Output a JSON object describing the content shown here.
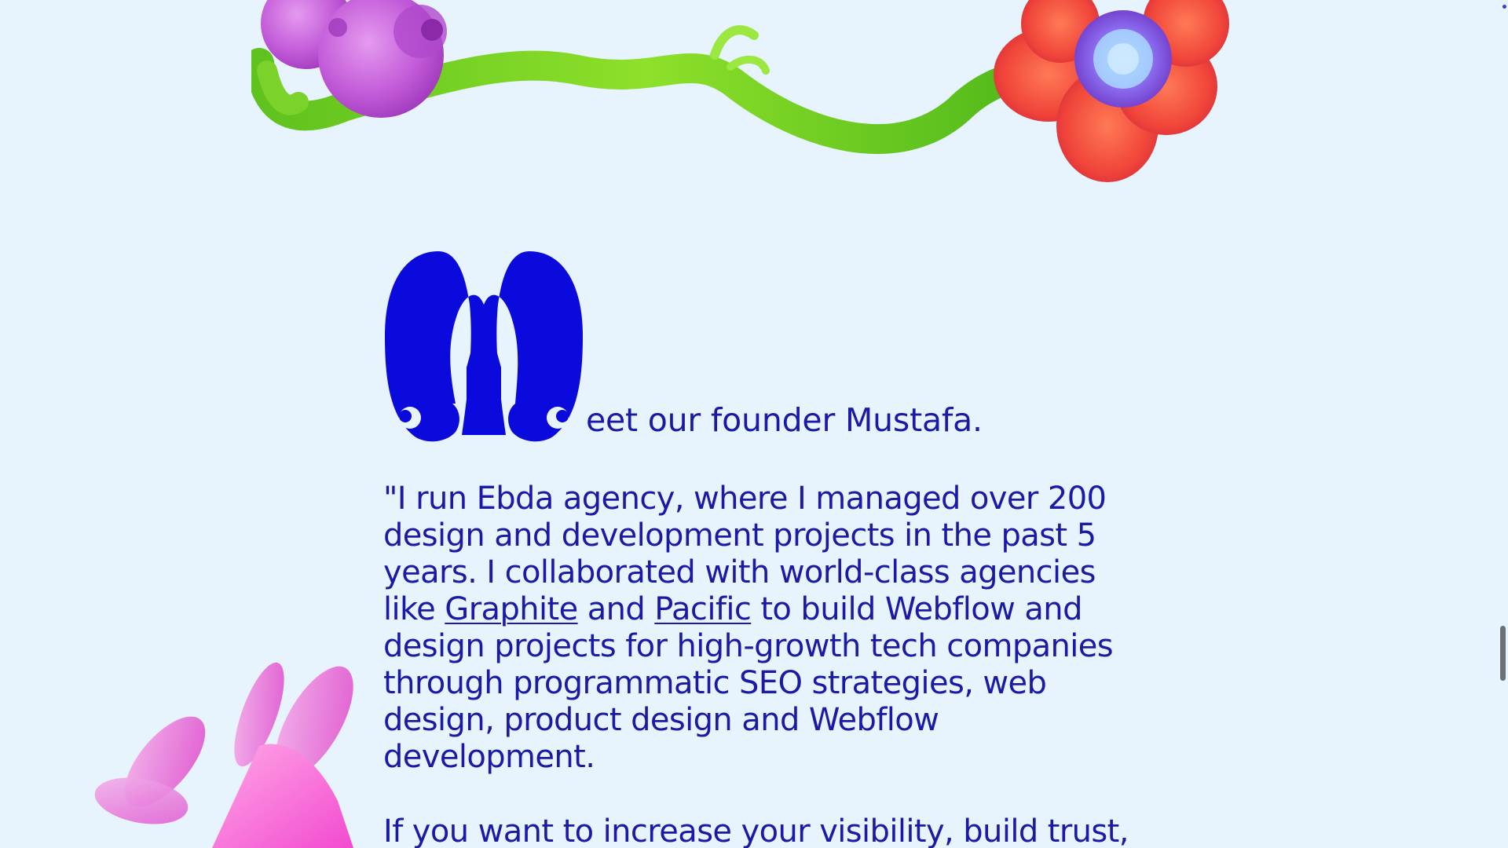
{
  "colors": {
    "background": "#e7f4fd",
    "text": "#1a1aa6",
    "accent": "#0a0adc"
  },
  "decorations": {
    "top": "flower-vine-illustration",
    "bottom": "pink-flower-illustration"
  },
  "heading": {
    "dropcap_letter": "M",
    "rest": "eet our founder Mustafa."
  },
  "quote": {
    "text_before": "\"I run Ebda agency, where I managed over 200 design and development projects in the past 5 years. I collaborated with world-class agencies like ",
    "link_graphite": "Graphite",
    "and_text": " and ",
    "link_pacific": "Pacific",
    "text_after": " to build Webflow and design projects for high-growth tech companies through programmatic SEO strategies, web design, product design and Webflow development."
  },
  "paragraph2": {
    "text": "If you want to increase your visibility, build trust, and differentiate your business from the"
  }
}
